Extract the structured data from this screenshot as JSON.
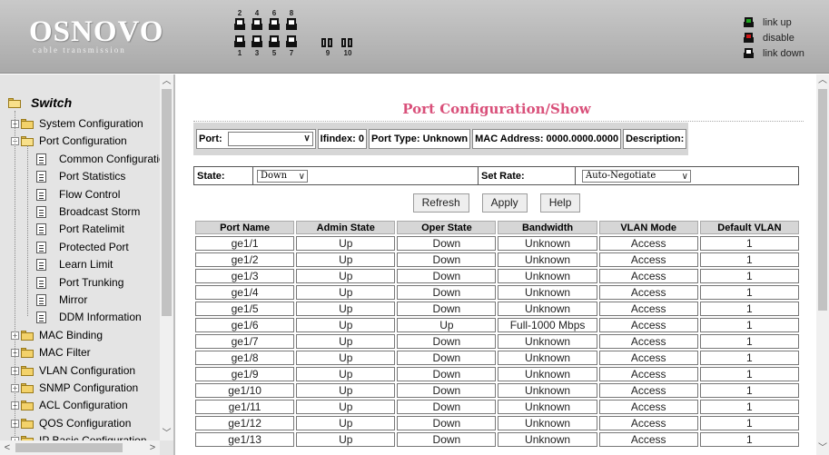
{
  "brand": {
    "name": "OSNOVO",
    "tagline": "cable transmission"
  },
  "panel": {
    "top_numbers": [
      "2",
      "4",
      "6",
      "8"
    ],
    "bottom_numbers": [
      "1",
      "3",
      "5",
      "7"
    ],
    "sfp_numbers": [
      "9",
      "10"
    ]
  },
  "legend": [
    {
      "label": "link up",
      "color": "#1fa61f"
    },
    {
      "label": "disable",
      "color": "#d01818"
    },
    {
      "label": "link down",
      "color": "#ffffff"
    }
  ],
  "sidebar": {
    "root": "Switch",
    "items": [
      {
        "label": "System Configuration",
        "type": "folder",
        "expander": "+"
      },
      {
        "label": "Port Configuration",
        "type": "folder-open",
        "expander": "−"
      },
      {
        "label": "Common Configuratio",
        "type": "page"
      },
      {
        "label": "Port Statistics",
        "type": "page"
      },
      {
        "label": "Flow Control",
        "type": "page"
      },
      {
        "label": "Broadcast Storm",
        "type": "page"
      },
      {
        "label": "Port Ratelimit",
        "type": "page"
      },
      {
        "label": "Protected Port",
        "type": "page"
      },
      {
        "label": "Learn Limit",
        "type": "page"
      },
      {
        "label": "Port Trunking",
        "type": "page"
      },
      {
        "label": "Mirror",
        "type": "page"
      },
      {
        "label": "DDM Information",
        "type": "page"
      },
      {
        "label": "MAC Binding",
        "type": "folder",
        "expander": "+"
      },
      {
        "label": "MAC Filter",
        "type": "folder",
        "expander": "+"
      },
      {
        "label": "VLAN Configuration",
        "type": "folder",
        "expander": "+"
      },
      {
        "label": "SNMP Configuration",
        "type": "folder",
        "expander": "+"
      },
      {
        "label": "ACL Configuration",
        "type": "folder",
        "expander": "+"
      },
      {
        "label": "QOS Configuration",
        "type": "folder",
        "expander": "+"
      },
      {
        "label": "IP Basic Configuration",
        "type": "folder",
        "expander": "+"
      }
    ]
  },
  "main": {
    "title": "Port Configuration/Show",
    "port_bar": {
      "port_label": "Port:",
      "port_value": "",
      "ifindex": "Ifindex: 0",
      "port_type": "Port Type: Unknown",
      "mac": "MAC Address: 0000.0000.0000",
      "description": "Description:"
    },
    "state_bar": {
      "state_label": "State:",
      "state_value": "Down",
      "rate_label": "Set Rate:",
      "rate_value": "Auto-Negotiate"
    },
    "buttons": {
      "refresh": "Refresh",
      "apply": "Apply",
      "help": "Help"
    },
    "table": {
      "columns": [
        "Port Name",
        "Admin State",
        "Oper State",
        "Bandwidth",
        "VLAN Mode",
        "Default VLAN"
      ],
      "rows": [
        [
          "ge1/1",
          "Up",
          "Down",
          "Unknown",
          "Access",
          "1"
        ],
        [
          "ge1/2",
          "Up",
          "Down",
          "Unknown",
          "Access",
          "1"
        ],
        [
          "ge1/3",
          "Up",
          "Down",
          "Unknown",
          "Access",
          "1"
        ],
        [
          "ge1/4",
          "Up",
          "Down",
          "Unknown",
          "Access",
          "1"
        ],
        [
          "ge1/5",
          "Up",
          "Down",
          "Unknown",
          "Access",
          "1"
        ],
        [
          "ge1/6",
          "Up",
          "Up",
          "Full-1000 Mbps",
          "Access",
          "1"
        ],
        [
          "ge1/7",
          "Up",
          "Down",
          "Unknown",
          "Access",
          "1"
        ],
        [
          "ge1/8",
          "Up",
          "Down",
          "Unknown",
          "Access",
          "1"
        ],
        [
          "ge1/9",
          "Up",
          "Down",
          "Unknown",
          "Access",
          "1"
        ],
        [
          "ge1/10",
          "Up",
          "Down",
          "Unknown",
          "Access",
          "1"
        ],
        [
          "ge1/11",
          "Up",
          "Down",
          "Unknown",
          "Access",
          "1"
        ],
        [
          "ge1/12",
          "Up",
          "Down",
          "Unknown",
          "Access",
          "1"
        ],
        [
          "ge1/13",
          "Up",
          "Down",
          "Unknown",
          "Access",
          "1"
        ]
      ]
    }
  }
}
